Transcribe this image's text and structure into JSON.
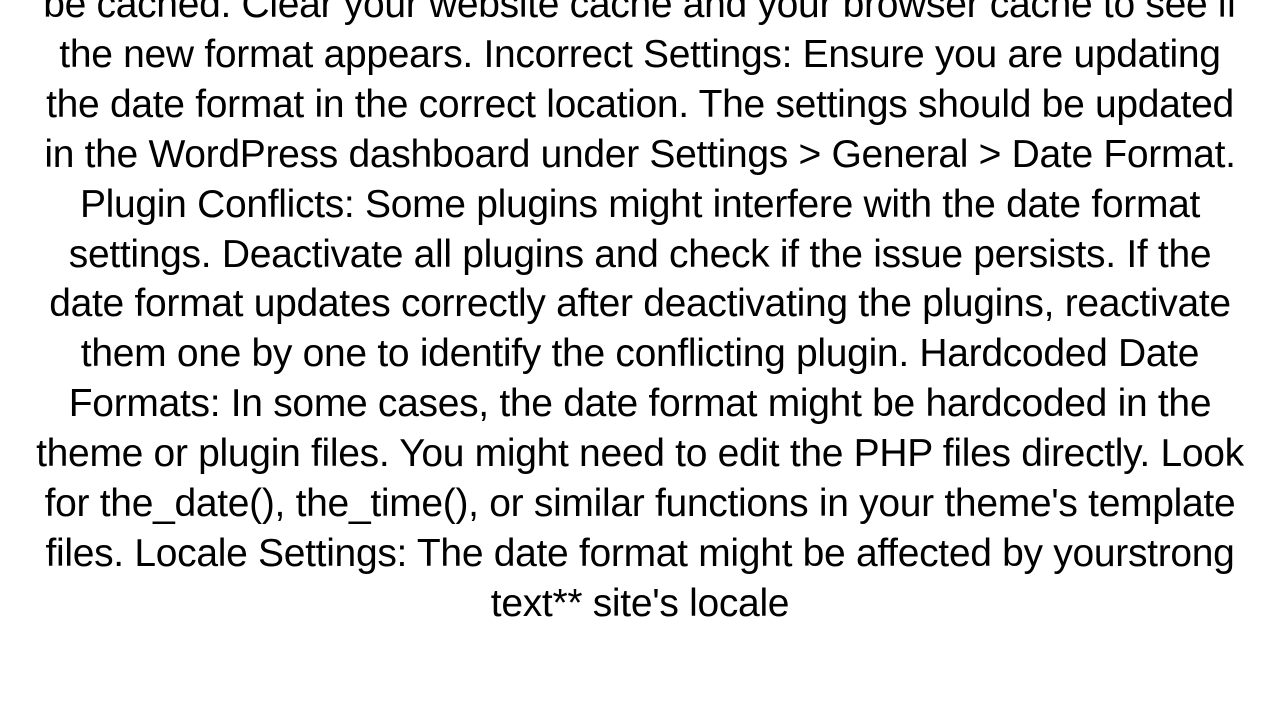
{
  "document": {
    "body_text": "be cached. Clear your website cache and your browser cache to see if the new format appears. Incorrect Settings: Ensure you are updating the date format in the correct location. The settings should be updated in the WordPress dashboard under Settings > General > Date Format. Plugin Conflicts: Some plugins might interfere with the date format settings. Deactivate all plugins and check if the issue persists. If the date format updates correctly after deactivating the plugins, reactivate them one by one to identify the conflicting plugin. Hardcoded Date Formats: In some cases, the date format might be hardcoded in the theme or plugin files. You might need to edit the PHP files directly. Look for the_date(), the_time(), or similar functions in your theme's template files. Locale Settings: The date format might be affected by yourstrong text** site's locale"
  }
}
